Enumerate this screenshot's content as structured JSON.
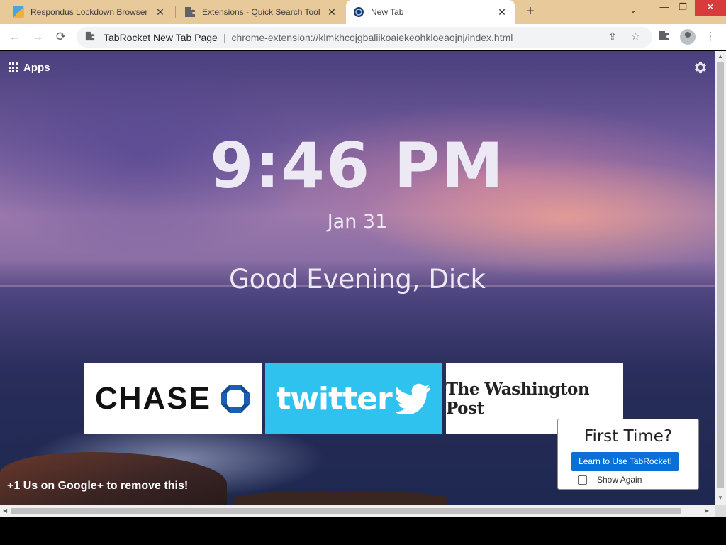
{
  "tabs": [
    {
      "title": "Respondus Lockdown Browser - ",
      "close": "✕",
      "favicon": "respondus-favicon"
    },
    {
      "title": "Extensions - Quick Search Tool",
      "close": "✕",
      "favicon": "puzzle-icon"
    },
    {
      "title": "New Tab",
      "close": "✕",
      "favicon": "tabrocket-favicon"
    }
  ],
  "tabstrip": {
    "new_tab": "+",
    "tab_list": "⌄",
    "minimize": "—",
    "restore": "❐",
    "close": "✕"
  },
  "toolbar": {
    "back": "←",
    "forward": "→",
    "reload": "⟳",
    "site_name": "TabRocket New Tab Page",
    "separator": "|",
    "url": "chrome-extension://klmkhcojgbaliikoaiekeohkloeaojnj/index.html",
    "share": "⇪",
    "bookmark": "☆",
    "extensions": "✦",
    "menu": "⋮"
  },
  "page": {
    "apps_label": "Apps",
    "clock": "9:46 PM",
    "date": "Jan 31",
    "greeting": "Good Evening, Dick",
    "tiles": [
      {
        "name": "chase",
        "label": "CHASE",
        "color": "#ffffff",
        "logo_color": "#1a5fb4"
      },
      {
        "name": "twitter",
        "label": "twitter",
        "color": "#2fc2ef"
      },
      {
        "name": "washington-post",
        "label": "The Washington Post",
        "color": "#ffffff"
      }
    ],
    "promo": "+1 Us on Google+ to remove this!",
    "first_time": {
      "title": "First Time?",
      "button": "Learn to Use TabRocket!",
      "checkbox_label": "Show Again",
      "checkbox_checked": false
    }
  },
  "scrollbars": {
    "up": "▲",
    "down": "▼",
    "left": "◀",
    "right": "▶"
  }
}
